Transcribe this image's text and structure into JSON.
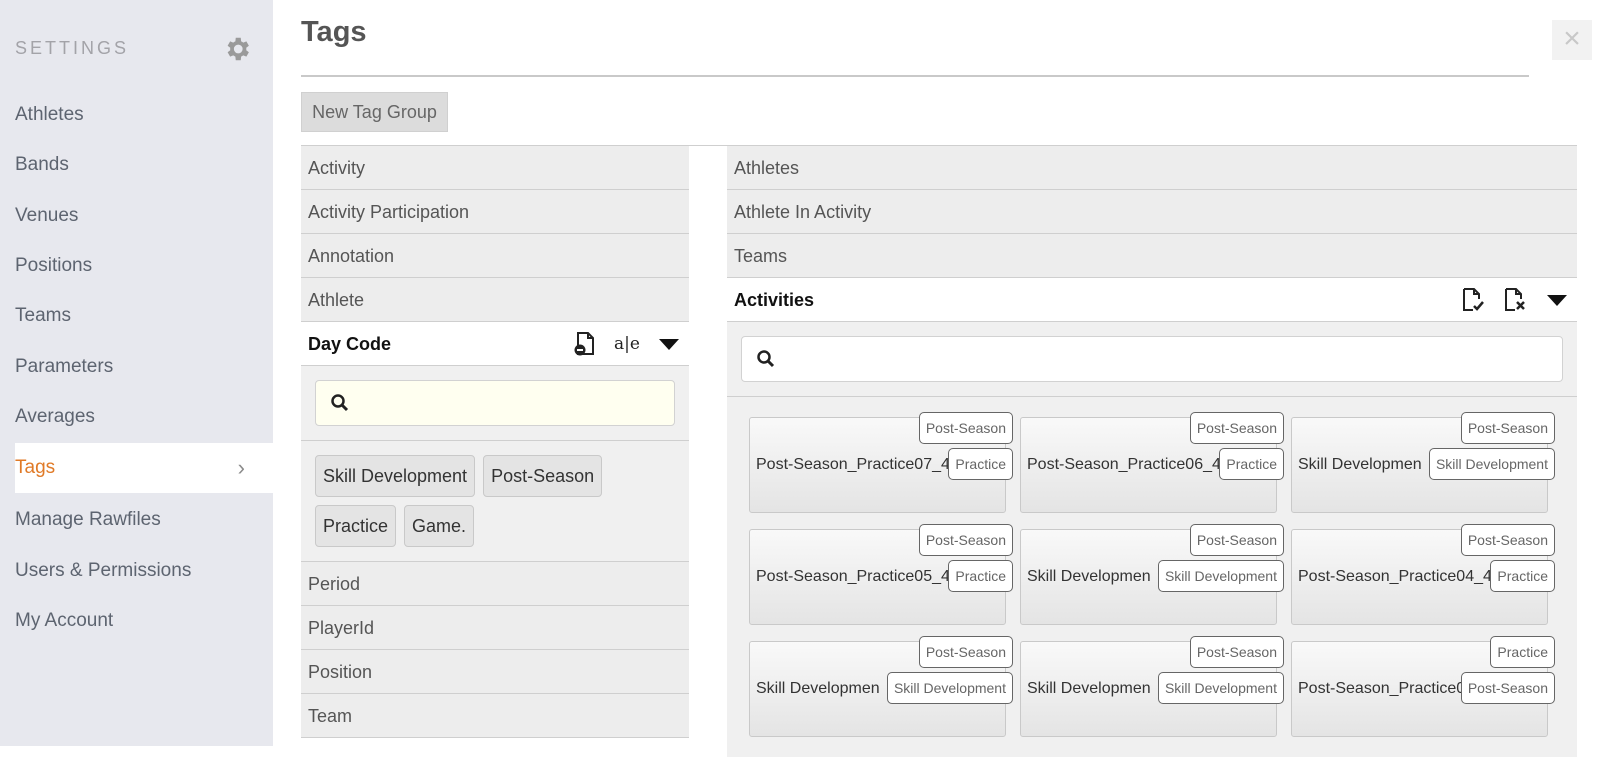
{
  "sidebar": {
    "title": "SETTINGS",
    "items": [
      {
        "label": "Athletes"
      },
      {
        "label": "Bands"
      },
      {
        "label": "Venues"
      },
      {
        "label": "Positions"
      },
      {
        "label": "Teams"
      },
      {
        "label": "Parameters"
      },
      {
        "label": "Averages"
      },
      {
        "label": "Tags",
        "active": true
      },
      {
        "label": "Manage Rawfiles"
      },
      {
        "label": "Users & Permissions"
      },
      {
        "label": "My Account"
      }
    ]
  },
  "main": {
    "title": "Tags",
    "close": "×",
    "new_group_label": "New Tag Group"
  },
  "left_groups_top": [
    "Activity",
    "Activity Participation",
    "Annotation",
    "Athlete"
  ],
  "left_open": {
    "label": "Day Code",
    "search_value": "",
    "chips": [
      "Skill Development",
      "Post-Season",
      "Practice",
      "Game."
    ]
  },
  "left_groups_bottom": [
    "Period",
    "PlayerId",
    "Position",
    "Team"
  ],
  "right_groups_top": [
    "Athletes",
    "Athlete In Activity",
    "Teams"
  ],
  "right_open": {
    "label": "Activities",
    "search_value": "",
    "cards": [
      {
        "name": "Post-Season_Practice07_4-",
        "tag_top": "Post-Season",
        "tag_bottom": "Practice"
      },
      {
        "name": "Post-Season_Practice06_4-",
        "tag_top": "Post-Season",
        "tag_bottom": "Practice"
      },
      {
        "name": "Skill Developmen",
        "tag_top": "Post-Season",
        "tag_bottom": "Skill Development"
      },
      {
        "name": "Post-Season_Practice05_4-",
        "tag_top": "Post-Season",
        "tag_bottom": "Practice"
      },
      {
        "name": "Skill Developmen",
        "tag_top": "Post-Season",
        "tag_bottom": "Skill Development"
      },
      {
        "name": "Post-Season_Practice04_4-",
        "tag_top": "Post-Season",
        "tag_bottom": "Practice"
      },
      {
        "name": "Skill Developmen",
        "tag_top": "Post-Season",
        "tag_bottom": "Skill Development"
      },
      {
        "name": "Skill Developmen",
        "tag_top": "Post-Season",
        "tag_bottom": "Skill Development"
      },
      {
        "name": "Post-Season_Practice0",
        "tag_top": "Practice",
        "tag_bottom": "Post-Season"
      }
    ]
  },
  "colors": {
    "accent": "#e07a27",
    "sidebar_bg": "#e7e8ee"
  }
}
